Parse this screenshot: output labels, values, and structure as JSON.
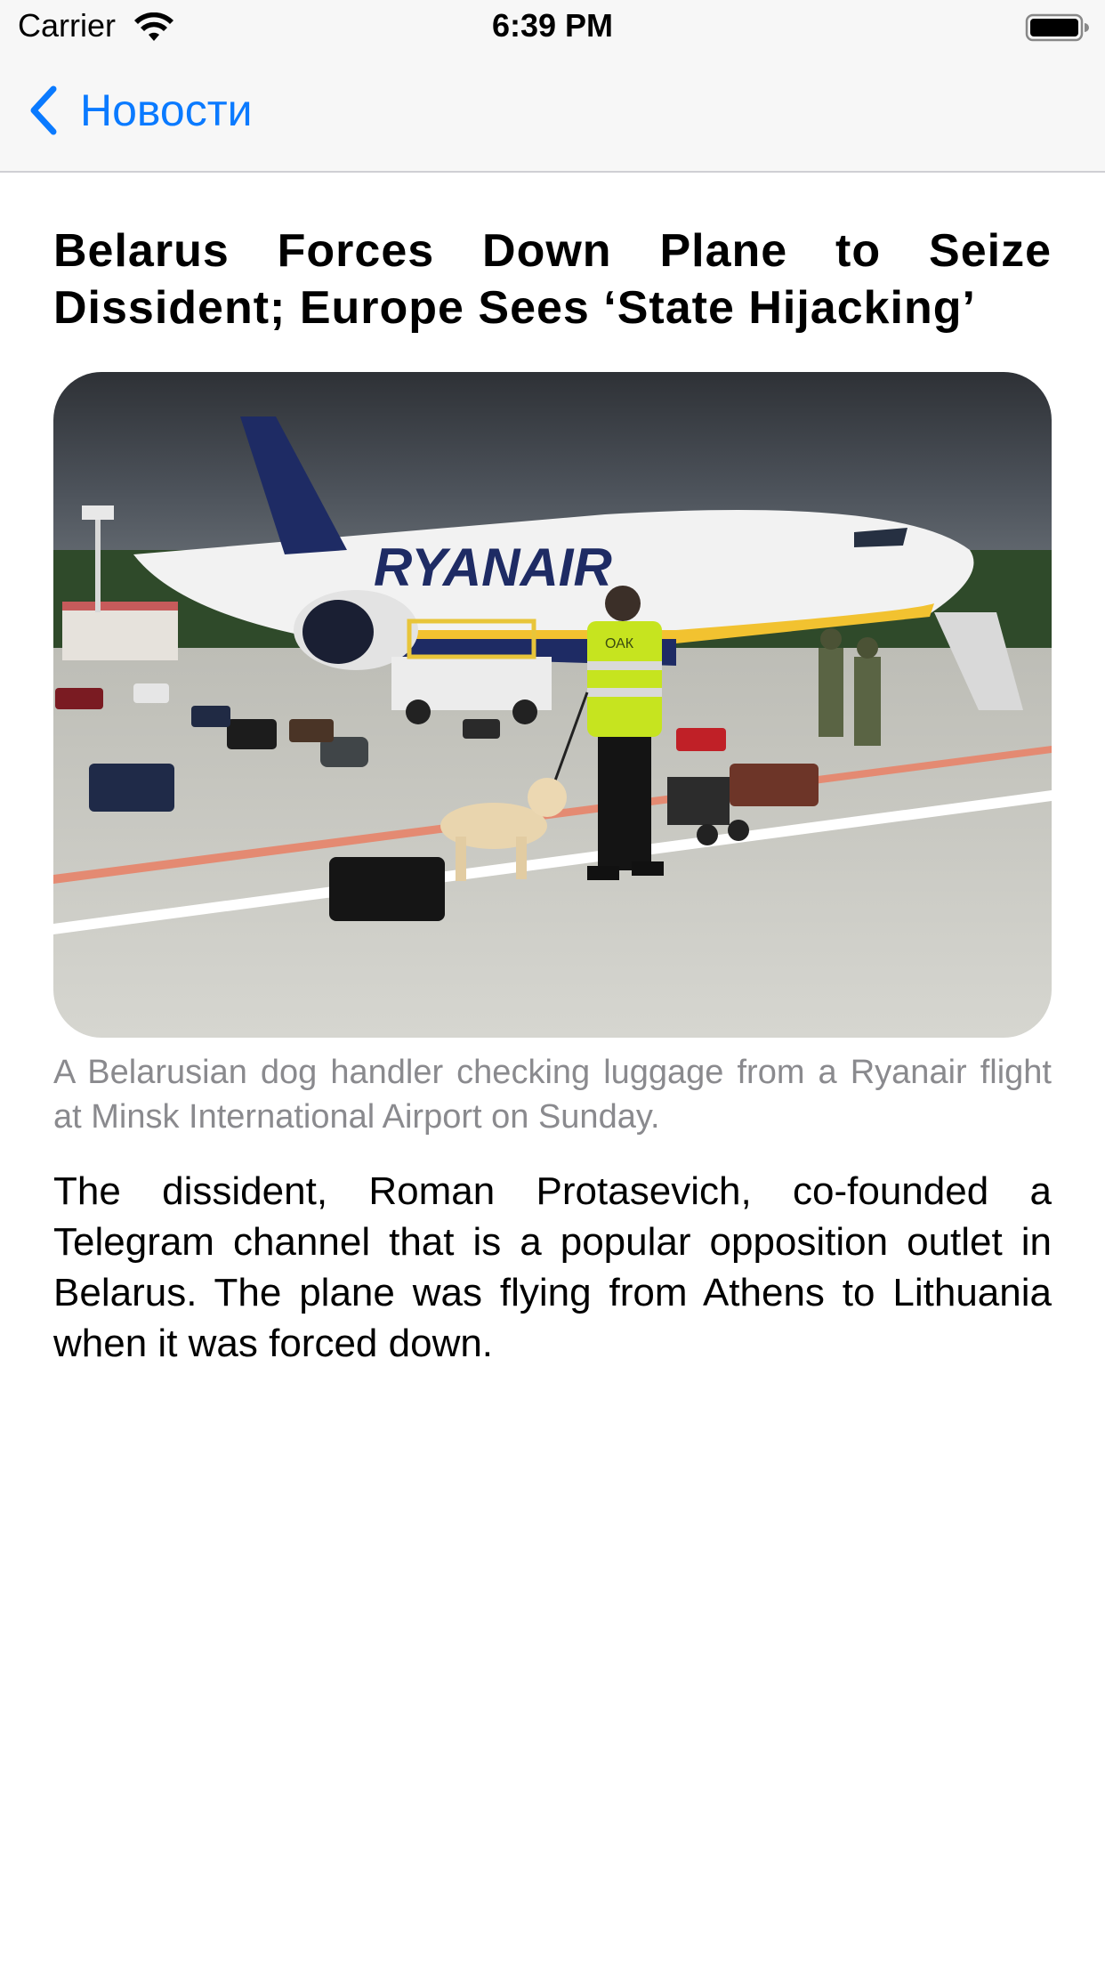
{
  "status_bar": {
    "carrier": "Carrier",
    "time": "6:39 PM",
    "wifi_icon": "wifi-icon",
    "battery_icon": "battery-full-icon"
  },
  "nav": {
    "back_label": "Новости",
    "back_icon": "chevron-left-icon",
    "accent_color": "#0a7aff"
  },
  "article": {
    "title": "Belarus Forces Down Plane to Seize Dissident; Europe Sees ‘State Hijacking’",
    "image": {
      "brand_text": "RYANAIR",
      "vest_text": "ОАК"
    },
    "caption": "A Belarusian dog handler checking luggage from a Ryanair flight at Minsk International Airport on Sunday.",
    "body": "The dissident, Roman Protasevich, co-founded a Telegram channel that is a popular opposition outlet in Belarus. The plane was flying from Athens to Lithuania when it was forced down."
  }
}
